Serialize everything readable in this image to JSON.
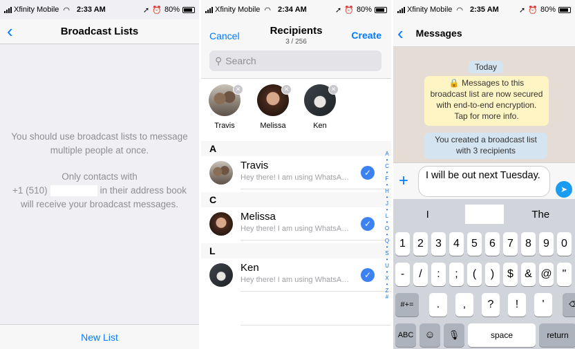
{
  "panel1": {
    "status": {
      "carrier": "Xfinity Mobile",
      "time": "2:33 AM",
      "battery": "80%"
    },
    "title": "Broadcast Lists",
    "info_1": "You should use broadcast lists to message multiple people at once.",
    "info_2a": "Only contacts with",
    "info_2b": "+1 (510)",
    "info_2c": "in their address book will receive your broadcast messages.",
    "new_list": "New List"
  },
  "panel2": {
    "status": {
      "carrier": "Xfinity Mobile",
      "time": "2:34 AM",
      "battery": "80%"
    },
    "cancel": "Cancel",
    "title": "Recipients",
    "count": "3 / 256",
    "create": "Create",
    "search_placeholder": "Search",
    "chips": [
      "Travis",
      "Melissa",
      "Ken"
    ],
    "sections": [
      {
        "letter": "A",
        "name": "Travis",
        "sub": "Hey there! I am using WhatsApp."
      },
      {
        "letter": "C",
        "name": "Melissa",
        "sub": "Hey there! I am using WhatsApp."
      },
      {
        "letter": "L",
        "name": "Ken",
        "sub": "Hey there! I am using WhatsApp."
      }
    ],
    "index_letters": [
      "A",
      "•",
      "C",
      "•",
      "F",
      "•",
      "H",
      "•",
      "J",
      "•",
      "L",
      "•",
      "O",
      "•",
      "Q",
      "•",
      "S",
      "•",
      "U",
      "•",
      "X",
      "•",
      "Z",
      "#"
    ]
  },
  "panel3": {
    "status": {
      "carrier": "Xfinity Mobile",
      "time": "2:35 AM",
      "battery": "80%"
    },
    "title": "Messages",
    "date_chip": "Today",
    "encryption_notice": "Messages to this broadcast list are now secured with end-to-end encryption. Tap for more info.",
    "created_notice": "You created a broadcast list with 3 recipients",
    "draft": "I will be out next Tuesday.",
    "suggestions": [
      "I",
      "",
      "The"
    ],
    "row1": [
      "1",
      "2",
      "3",
      "4",
      "5",
      "6",
      "7",
      "8",
      "9",
      "0"
    ],
    "row2": [
      "-",
      "/",
      ":",
      ";",
      "(",
      ")",
      "$",
      "&",
      "@",
      "\""
    ],
    "row3_left": "#+=",
    "row3": [
      ".",
      ",",
      "?",
      "!",
      "'"
    ],
    "abc": "ABC",
    "space": "space",
    "return": "return"
  },
  "colors": {
    "accent": "#007aff",
    "check": "#3c82f0",
    "send": "#1a9cf0",
    "notice_yellow": "#fff5c4",
    "notice_blue": "#d5e4f1"
  }
}
